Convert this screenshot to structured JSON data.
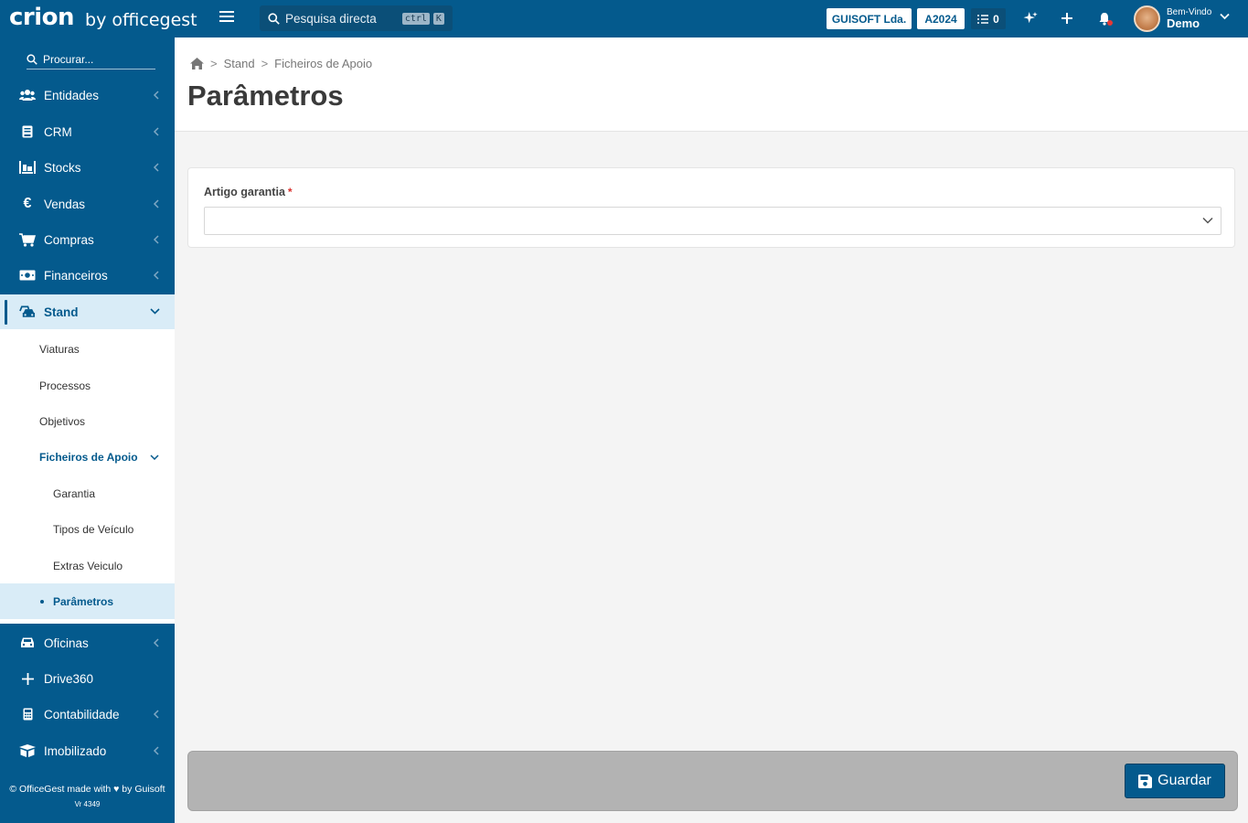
{
  "brand": {
    "name": "crion",
    "by": "by officegest"
  },
  "topbar": {
    "search_placeholder": "Pesquisa directa",
    "kbd_ctrl": "ctrl",
    "kbd_k": "K",
    "company": "GUISOFT Lda.",
    "year": "A2024",
    "tasks_count": "0",
    "welcome_small": "Bem-Vindo",
    "welcome_name": "Demo"
  },
  "sidebar": {
    "search_placeholder": "Procurar...",
    "items": [
      {
        "label": "Entidades",
        "icon": "users-icon"
      },
      {
        "label": "CRM",
        "icon": "book-icon"
      },
      {
        "label": "Stocks",
        "icon": "warehouse-icon"
      },
      {
        "label": "Vendas",
        "icon": "euro-icon"
      },
      {
        "label": "Compras",
        "icon": "cart-icon"
      },
      {
        "label": "Financeiros",
        "icon": "money-icon"
      },
      {
        "label": "Stand",
        "icon": "car-stand-icon"
      },
      {
        "label": "Oficinas",
        "icon": "car-icon"
      },
      {
        "label": "Drive360",
        "icon": "plus-icon"
      },
      {
        "label": "Contabilidade",
        "icon": "calculator-icon"
      },
      {
        "label": "Imobilizado",
        "icon": "boxes-icon"
      }
    ],
    "stand_sub": [
      {
        "label": "Viaturas"
      },
      {
        "label": "Processos"
      },
      {
        "label": "Objetivos"
      },
      {
        "label": "Ficheiros de Apoio"
      },
      {
        "label": "Garantia"
      },
      {
        "label": "Tipos de Veículo"
      },
      {
        "label": "Extras Veiculo"
      },
      {
        "label": "Parâmetros"
      }
    ],
    "footer_line": "© OfficeGest made with ♥ by Guisoft",
    "version": "Vr 4349"
  },
  "breadcrumb": [
    "Stand",
    "Ficheiros de Apoio"
  ],
  "page": {
    "title": "Parâmetros"
  },
  "form": {
    "field_label": "Artigo garantia",
    "required_mark": "*",
    "field_value": ""
  },
  "actions": {
    "save_label": "Guardar"
  },
  "colors": {
    "primary": "#045a8d",
    "active_bg": "#d9ecf7",
    "required": "#d9302c"
  }
}
